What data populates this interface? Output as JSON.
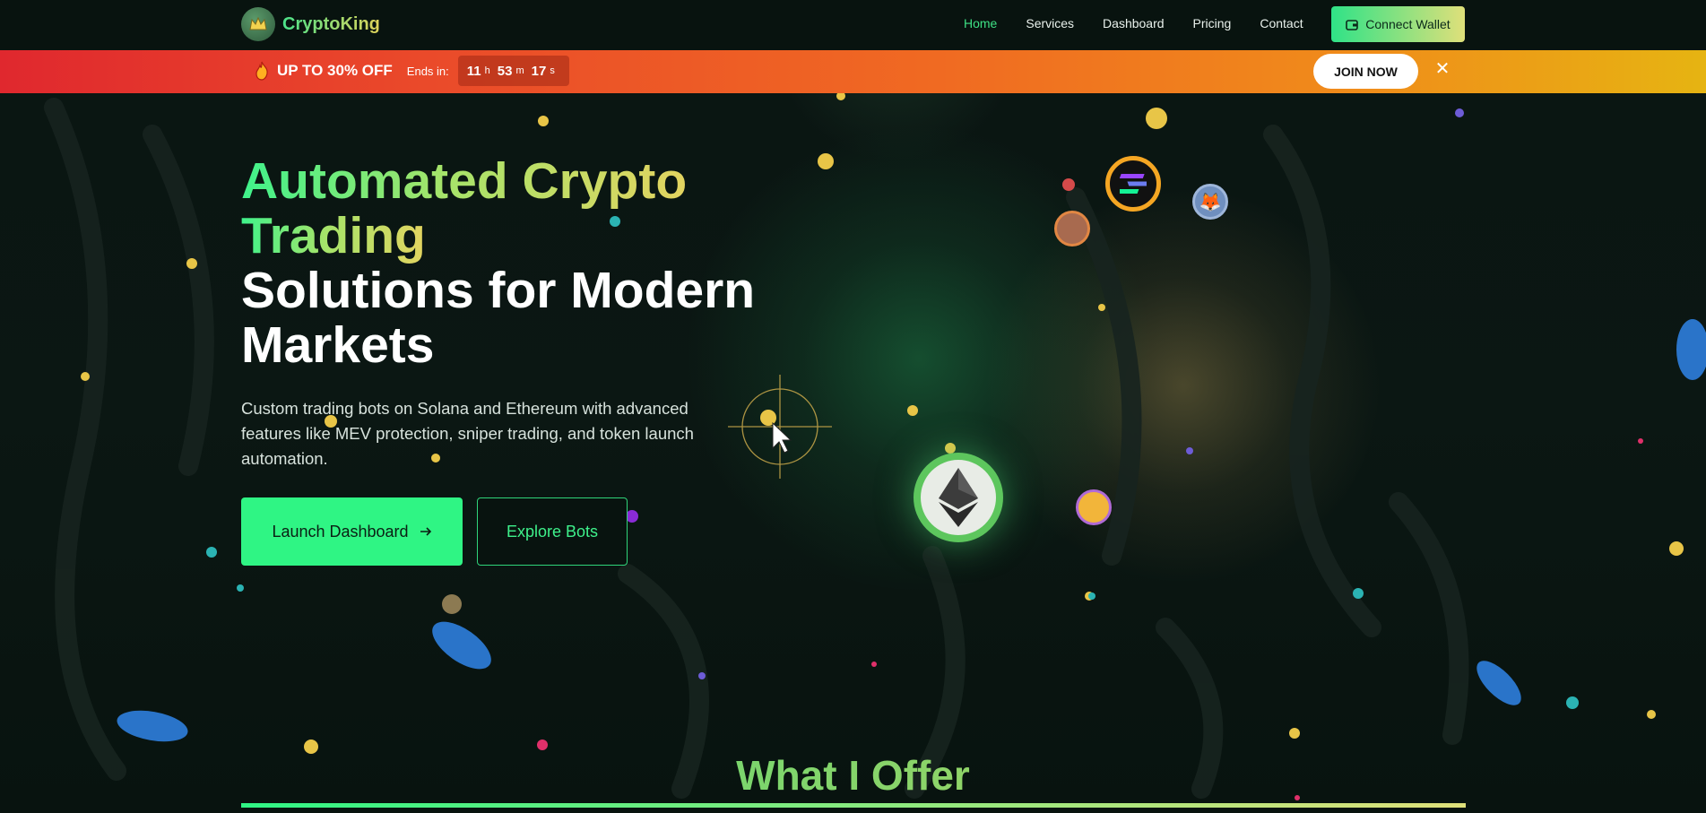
{
  "brand": {
    "name": "CryptoKing",
    "logo_icon": "crown-icon"
  },
  "nav": {
    "links": [
      "Home",
      "Services",
      "Dashboard",
      "Pricing",
      "Contact"
    ],
    "active": "Home",
    "wallet_button": "Connect Wallet"
  },
  "promo": {
    "title": "UP TO 30% OFF",
    "ends_label": "Ends in:",
    "timer": {
      "hours": "11",
      "hours_unit": "h",
      "minutes": "53",
      "minutes_unit": "m",
      "seconds": "17",
      "seconds_unit": "s"
    },
    "join_button": "JOIN NOW",
    "close_icon": "close-icon"
  },
  "hero": {
    "title_highlight_1": "Automated Crypto",
    "title_highlight_2": "Trading",
    "title_white_1": "Solutions for Modern",
    "title_white_2": "Markets",
    "description": "Custom trading bots on Solana and Ethereum with advanced features like MEV protection, sniper trading, and token launch automation.",
    "primary_button": "Launch Dashboard",
    "primary_button_icon": "arrow-right-icon",
    "secondary_button": "Explore Bots"
  },
  "section": {
    "title": "What I Offer"
  },
  "colors": {
    "accent_green": "#2ff584",
    "accent_gold": "#dfe07a",
    "background": "#07120f",
    "promo_start": "#e0282e",
    "promo_end": "#e6b412"
  }
}
